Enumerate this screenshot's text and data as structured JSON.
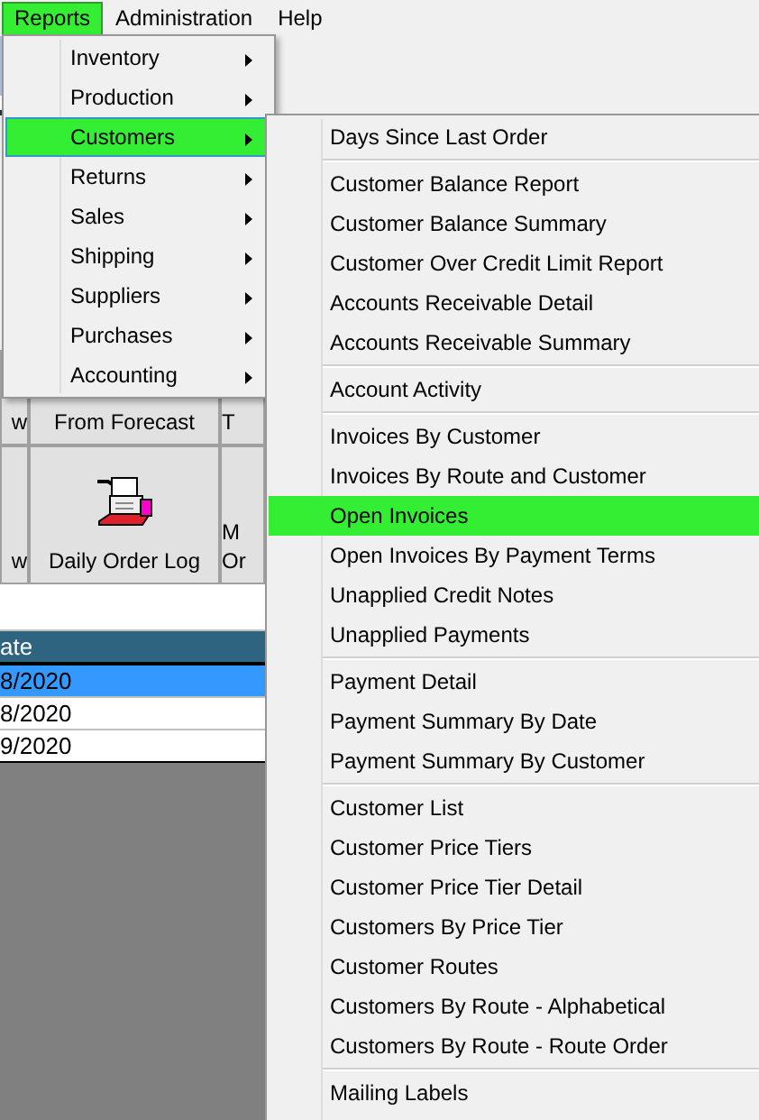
{
  "menubar": [
    {
      "label": "Reports",
      "selected": true
    },
    {
      "label": "Administration",
      "selected": false
    },
    {
      "label": "Help",
      "selected": false
    }
  ],
  "toolbar_buttons": [
    [
      {
        "lines": [
          "w"
        ],
        "icon": false
      },
      {
        "lines": [
          "From Forecast"
        ],
        "icon": false
      },
      {
        "lines": [
          "T"
        ],
        "icon": false
      }
    ],
    [
      {
        "lines": [
          "w"
        ],
        "icon": false
      },
      {
        "lines": [
          "Daily Order Log"
        ],
        "icon": true
      },
      {
        "lines": [
          "M",
          "Or"
        ],
        "icon": false
      }
    ]
  ],
  "table": {
    "columns": [
      "ate"
    ],
    "rows": [
      {
        "cells": [
          "8/2020"
        ],
        "selected": true
      },
      {
        "cells": [
          "8/2020"
        ],
        "selected": false
      },
      {
        "cells": [
          "9/2020"
        ],
        "selected": false
      }
    ]
  },
  "reports_menu": [
    {
      "label": "Inventory",
      "selected": false
    },
    {
      "label": "Production",
      "selected": false
    },
    {
      "label": "Customers",
      "selected": true
    },
    {
      "label": "Returns",
      "selected": false
    },
    {
      "label": "Sales",
      "selected": false
    },
    {
      "label": "Shipping",
      "selected": false
    },
    {
      "label": "Suppliers",
      "selected": false
    },
    {
      "label": "Purchases",
      "selected": false
    },
    {
      "label": "Accounting",
      "selected": false
    }
  ],
  "customers_menu": [
    [
      {
        "label": "Days Since Last Order",
        "selected": false
      }
    ],
    [
      {
        "label": "Customer Balance Report",
        "selected": false
      },
      {
        "label": "Customer Balance Summary",
        "selected": false
      },
      {
        "label": "Customer Over Credit Limit Report",
        "selected": false
      },
      {
        "label": "Accounts Receivable Detail",
        "selected": false
      },
      {
        "label": "Accounts Receivable Summary",
        "selected": false
      }
    ],
    [
      {
        "label": "Account Activity",
        "selected": false
      }
    ],
    [
      {
        "label": "Invoices By Customer",
        "selected": false
      },
      {
        "label": "Invoices By Route and Customer",
        "selected": false
      },
      {
        "label": "Open Invoices",
        "selected": true
      },
      {
        "label": "Open Invoices By Payment Terms",
        "selected": false
      },
      {
        "label": "Unapplied Credit Notes",
        "selected": false
      },
      {
        "label": "Unapplied Payments",
        "selected": false
      }
    ],
    [
      {
        "label": "Payment Detail",
        "selected": false
      },
      {
        "label": "Payment Summary By Date",
        "selected": false
      },
      {
        "label": "Payment Summary By Customer",
        "selected": false
      }
    ],
    [
      {
        "label": "Customer List",
        "selected": false
      },
      {
        "label": "Customer Price Tiers",
        "selected": false
      },
      {
        "label": "Customer Price Tier Detail",
        "selected": false
      },
      {
        "label": "Customers By Price Tier",
        "selected": false
      },
      {
        "label": "Customer Routes",
        "selected": false
      },
      {
        "label": "Customers By Route - Alphabetical",
        "selected": false
      },
      {
        "label": "Customers By Route - Route Order",
        "selected": false
      }
    ],
    [
      {
        "label": "Mailing Labels",
        "selected": false
      }
    ]
  ]
}
